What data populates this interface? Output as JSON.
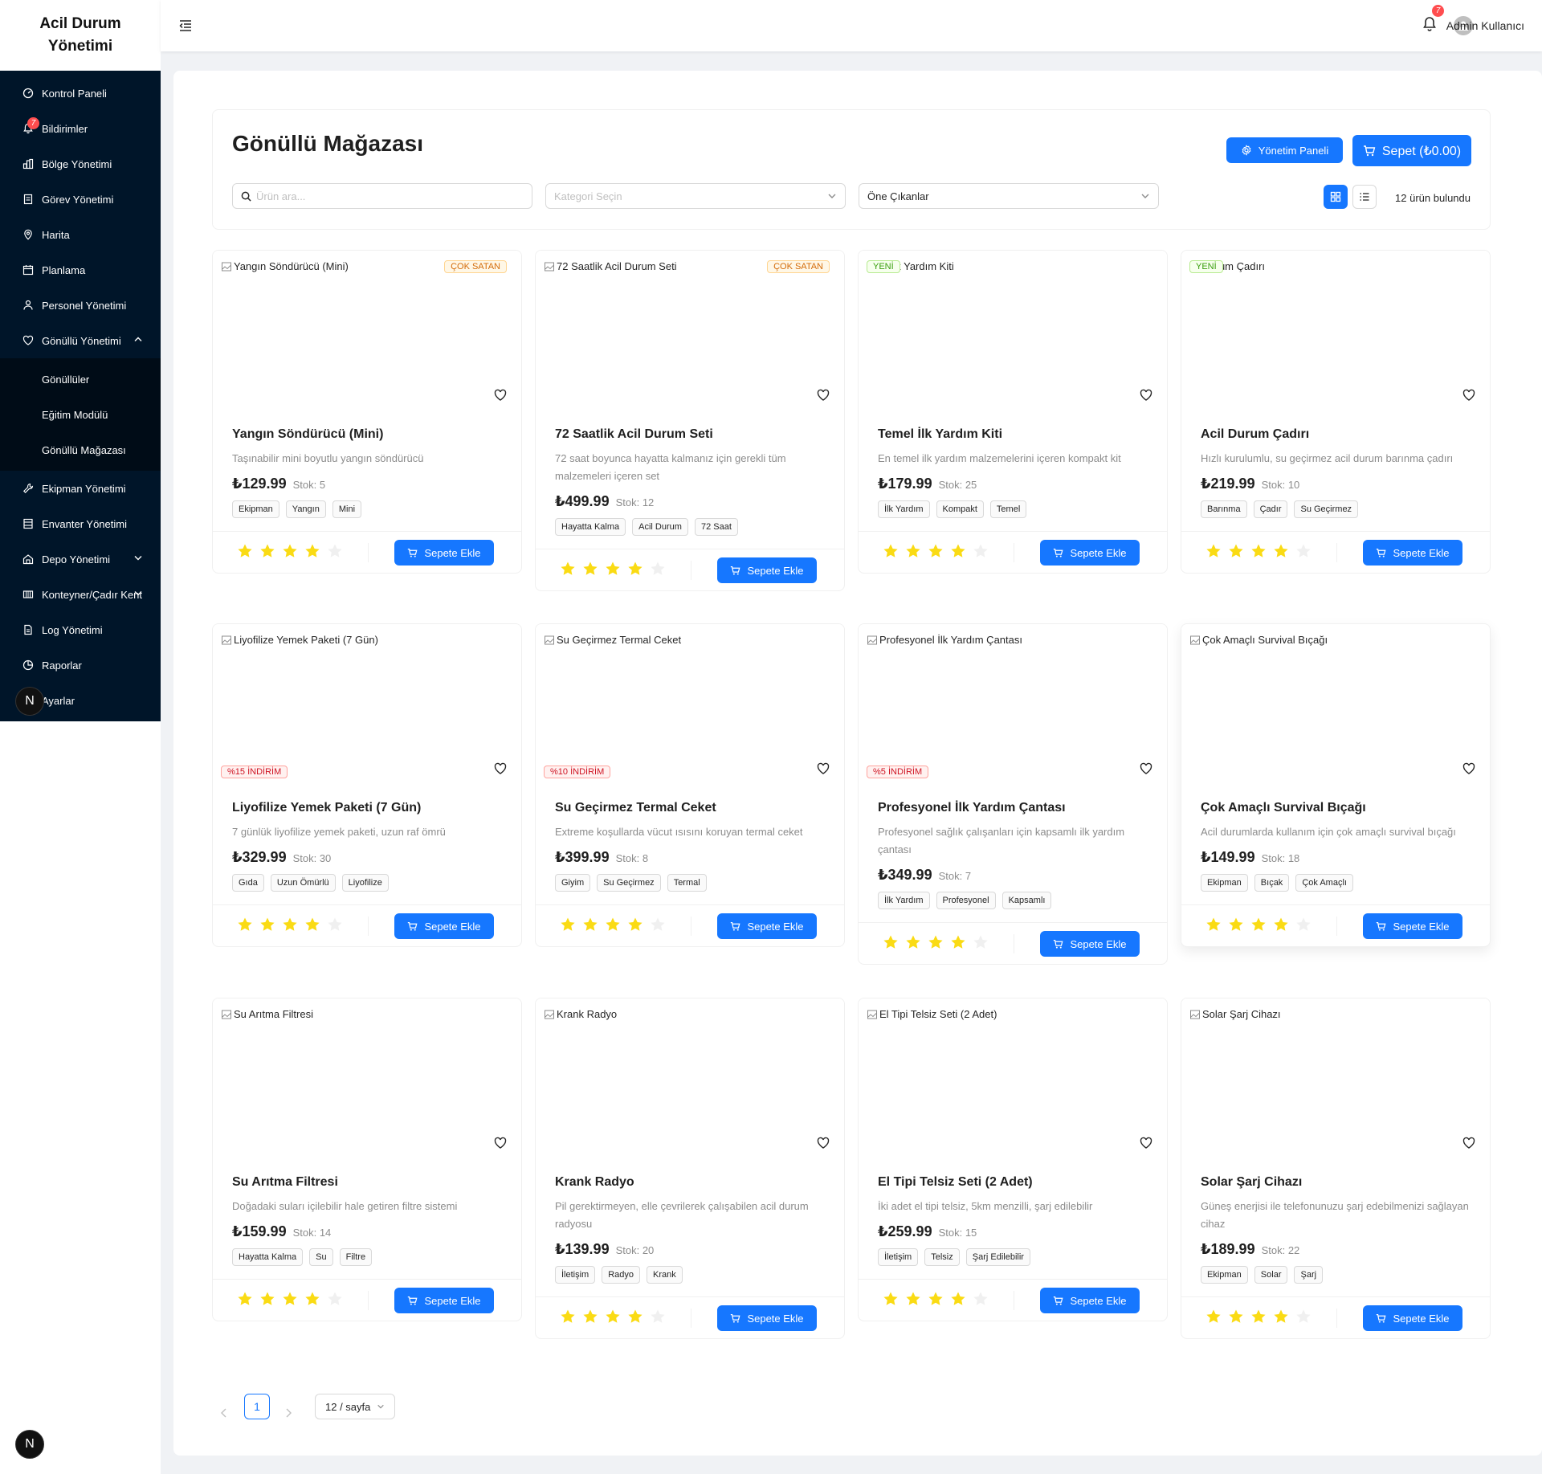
{
  "app": {
    "title_line1": "Acil Durum",
    "title_line2": "Yönetimi"
  },
  "sidebar": {
    "items": [
      {
        "label": "Kontrol Paneli",
        "icon": "dashboard-icon"
      },
      {
        "label": "Bildirimler",
        "icon": "bell-icon",
        "badge": "7"
      },
      {
        "label": "Bölge Yönetimi",
        "icon": "region-icon"
      },
      {
        "label": "Görev Yönetimi",
        "icon": "task-icon"
      },
      {
        "label": "Harita",
        "icon": "map-pin-icon"
      },
      {
        "label": "Planlama",
        "icon": "calendar-icon"
      },
      {
        "label": "Personel Yönetimi",
        "icon": "staff-icon"
      },
      {
        "label": "Gönüllü Yönetimi",
        "icon": "heart-icon"
      }
    ],
    "sub_items": [
      {
        "label": "Gönüllüler"
      },
      {
        "label": "Eğitim Modülü"
      },
      {
        "label": "Gönüllü Mağazası"
      }
    ],
    "items_after": [
      {
        "label": "Ekipman Yönetimi",
        "icon": "tool-icon"
      },
      {
        "label": "Envanter Yönetimi",
        "icon": "inventory-icon"
      },
      {
        "label": "Depo Yönetimi",
        "icon": "warehouse-icon"
      },
      {
        "label": "Konteyner/Çadır Kent",
        "icon": "container-icon"
      },
      {
        "label": "Log Yönetimi",
        "icon": "log-icon"
      },
      {
        "label": "Raporlar",
        "icon": "report-icon"
      },
      {
        "label": "Ayarlar",
        "icon": "settings-icon"
      }
    ],
    "n_logo": "N"
  },
  "header": {
    "notif_badge": "7",
    "user_name": "Admin Kullanıcı"
  },
  "store": {
    "title": "Gönüllü Mağazası",
    "admin_button": "Yönetim Paneli",
    "cart_button": "Sepet (₺0.00)",
    "search_placeholder": "Ürün ara...",
    "category_placeholder": "Kategori Seçin",
    "sort_value": "Öne Çıkanlar",
    "result_count": "12 ürün bulundu"
  },
  "products": [
    {
      "name": "Yangın Söndürücü (Mini)",
      "alt": "Yangın Söndürücü (Mini)",
      "badge": "ÇOK SATAN",
      "badge_type": "hot",
      "desc": "Taşınabilir mini boyutlu yangın söndürücü",
      "price": "₺129.99",
      "stock": "Stok: 5",
      "tags": [
        "Ekipman",
        "Yangın",
        "Mini"
      ],
      "rating": 4
    },
    {
      "name": "72 Saatlik Acil Durum Seti",
      "alt": "72 Saatlik Acil Durum Seti",
      "badge": "ÇOK SATAN",
      "badge_type": "hot",
      "desc": "72 saat boyunca hayatta kalmanız için gerekli tüm malzemeleri içeren set",
      "price": "₺499.99",
      "stock": "Stok: 12",
      "tags": [
        "Hayatta Kalma",
        "Acil Durum",
        "72 Saat"
      ],
      "rating": 4
    },
    {
      "name": "Temel İlk Yardım Kiti",
      "alt": "el İlk Yardım Kiti",
      "badge": "YENİ",
      "badge_type": "new",
      "desc": "En temel ilk yardım malzemelerini içeren kompakt kit",
      "price": "₺179.99",
      "stock": "Stok: 25",
      "tags": [
        "İlk Yardım",
        "Kompakt",
        "Temel"
      ],
      "rating": 4
    },
    {
      "name": "Acil Durum Çadırı",
      "alt": "Durum Çadırı",
      "badge": "YENİ",
      "badge_type": "new",
      "desc": "Hızlı kurulumlu, su geçirmez acil durum barınma çadırı",
      "price": "₺219.99",
      "stock": "Stok: 10",
      "tags": [
        "Barınma",
        "Çadır",
        "Su Geçirmez"
      ],
      "rating": 4
    },
    {
      "name": "Liyofilize Yemek Paketi (7 Gün)",
      "alt": "Liyofilize Yemek Paketi (7 Gün)",
      "discount": "%15 İNDİRİM",
      "desc": "7 günlük liyofilize yemek paketi, uzun raf ömrü",
      "price": "₺329.99",
      "stock": "Stok: 30",
      "tags": [
        "Gıda",
        "Uzun Ömürlü",
        "Liyofilize"
      ],
      "rating": 4
    },
    {
      "name": "Su Geçirmez Termal Ceket",
      "alt": "Su Geçirmez Termal Ceket",
      "discount": "%10 İNDİRİM",
      "desc": "Extreme koşullarda vücut ısısını koruyan termal ceket",
      "price": "₺399.99",
      "stock": "Stok: 8",
      "tags": [
        "Giyim",
        "Su Geçirmez",
        "Termal"
      ],
      "rating": 4
    },
    {
      "name": "Profesyonel İlk Yardım Çantası",
      "alt": "Profesyonel İlk Yardım Çantası",
      "discount": "%5 İNDİRİM",
      "desc": "Profesyonel sağlık çalışanları için kapsamlı ilk yardım çantası",
      "price": "₺349.99",
      "stock": "Stok: 7",
      "tags": [
        "İlk Yardım",
        "Profesyonel",
        "Kapsamlı"
      ],
      "rating": 4
    },
    {
      "name": "Çok Amaçlı Survival Bıçağı",
      "alt": "Çok Amaçlı Survival Bıçağı",
      "desc": "Acil durumlarda kullanım için çok amaçlı survival bıçağı",
      "price": "₺149.99",
      "stock": "Stok: 18",
      "tags": [
        "Ekipman",
        "Bıçak",
        "Çok Amaçlı"
      ],
      "rating": 4
    },
    {
      "name": "Su Arıtma Filtresi",
      "alt": "Su Arıtma Filtresi",
      "desc": "Doğadaki suları içilebilir hale getiren filtre sistemi",
      "price": "₺159.99",
      "stock": "Stok: 14",
      "tags": [
        "Hayatta Kalma",
        "Su",
        "Filtre"
      ],
      "rating": 4
    },
    {
      "name": "Krank Radyo",
      "alt": "Krank Radyo",
      "desc": "Pil gerektirmeyen, elle çevrilerek çalışabilen acil durum radyosu",
      "price": "₺139.99",
      "stock": "Stok: 20",
      "tags": [
        "İletişim",
        "Radyo",
        "Krank"
      ],
      "rating": 4
    },
    {
      "name": "El Tipi Telsiz Seti (2 Adet)",
      "alt": "El Tipi Telsiz Seti (2 Adet)",
      "desc": "İki adet el tipi telsiz, 5km menzilli, şarj edilebilir",
      "price": "₺259.99",
      "stock": "Stok: 15",
      "tags": [
        "İletişim",
        "Telsiz",
        "Şarj Edilebilir"
      ],
      "rating": 4
    },
    {
      "name": "Solar Şarj Cihazı",
      "alt": "Solar Şarj Cihazı",
      "desc": "Güneş enerjisi ile telefonunuzu şarj edebilmenizi sağlayan cihaz",
      "price": "₺189.99",
      "stock": "Stok: 22",
      "tags": [
        "Ekipman",
        "Solar",
        "Şarj"
      ],
      "rating": 4
    }
  ],
  "add_to_cart": "Sepete Ekle",
  "pagination": {
    "current": "1",
    "page_size": "12 / sayfa"
  },
  "colors": {
    "primary": "#1677ff",
    "sidebar": "#001529",
    "star": "#fadb14",
    "star_empty": "#f0f0f0"
  }
}
